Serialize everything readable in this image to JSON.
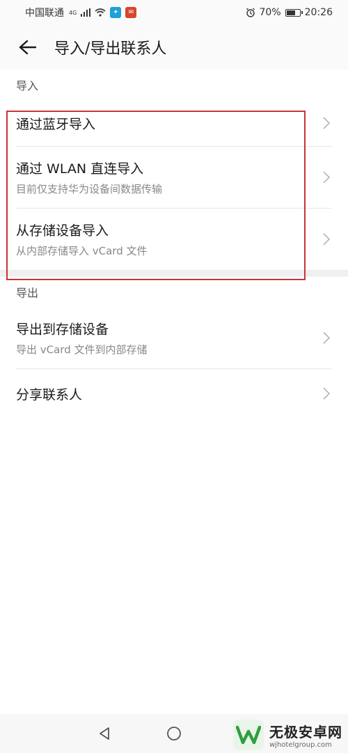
{
  "status_bar": {
    "carrier": "中国联通",
    "network_tag": "4G",
    "battery_percent": "70%",
    "battery_level": 0.7,
    "time": "20:26",
    "icons": [
      "signal-icon",
      "wifi-icon",
      "app-badge-icon",
      "app-badge-icon",
      "alarm-icon",
      "battery-icon"
    ]
  },
  "app_bar": {
    "title": "导入/导出联系人"
  },
  "sections": {
    "import": {
      "header": "导入",
      "items": [
        {
          "title": "通过蓝牙导入",
          "subtitle": ""
        },
        {
          "title": "通过 WLAN 直连导入",
          "subtitle": "目前仅支持华为设备间数据传输"
        },
        {
          "title": "从存储设备导入",
          "subtitle": "从内部存储导入 vCard 文件"
        }
      ]
    },
    "export": {
      "header": "导出",
      "items": [
        {
          "title": "导出到存储设备",
          "subtitle": "导出 vCard 文件到内部存储"
        },
        {
          "title": "分享联系人",
          "subtitle": ""
        }
      ]
    }
  },
  "watermark": {
    "title": "无极安卓网",
    "url": "wjhotelgroup.com"
  },
  "colors": {
    "highlight": "#c8323b",
    "watermark_green": "#2e9e3e"
  }
}
